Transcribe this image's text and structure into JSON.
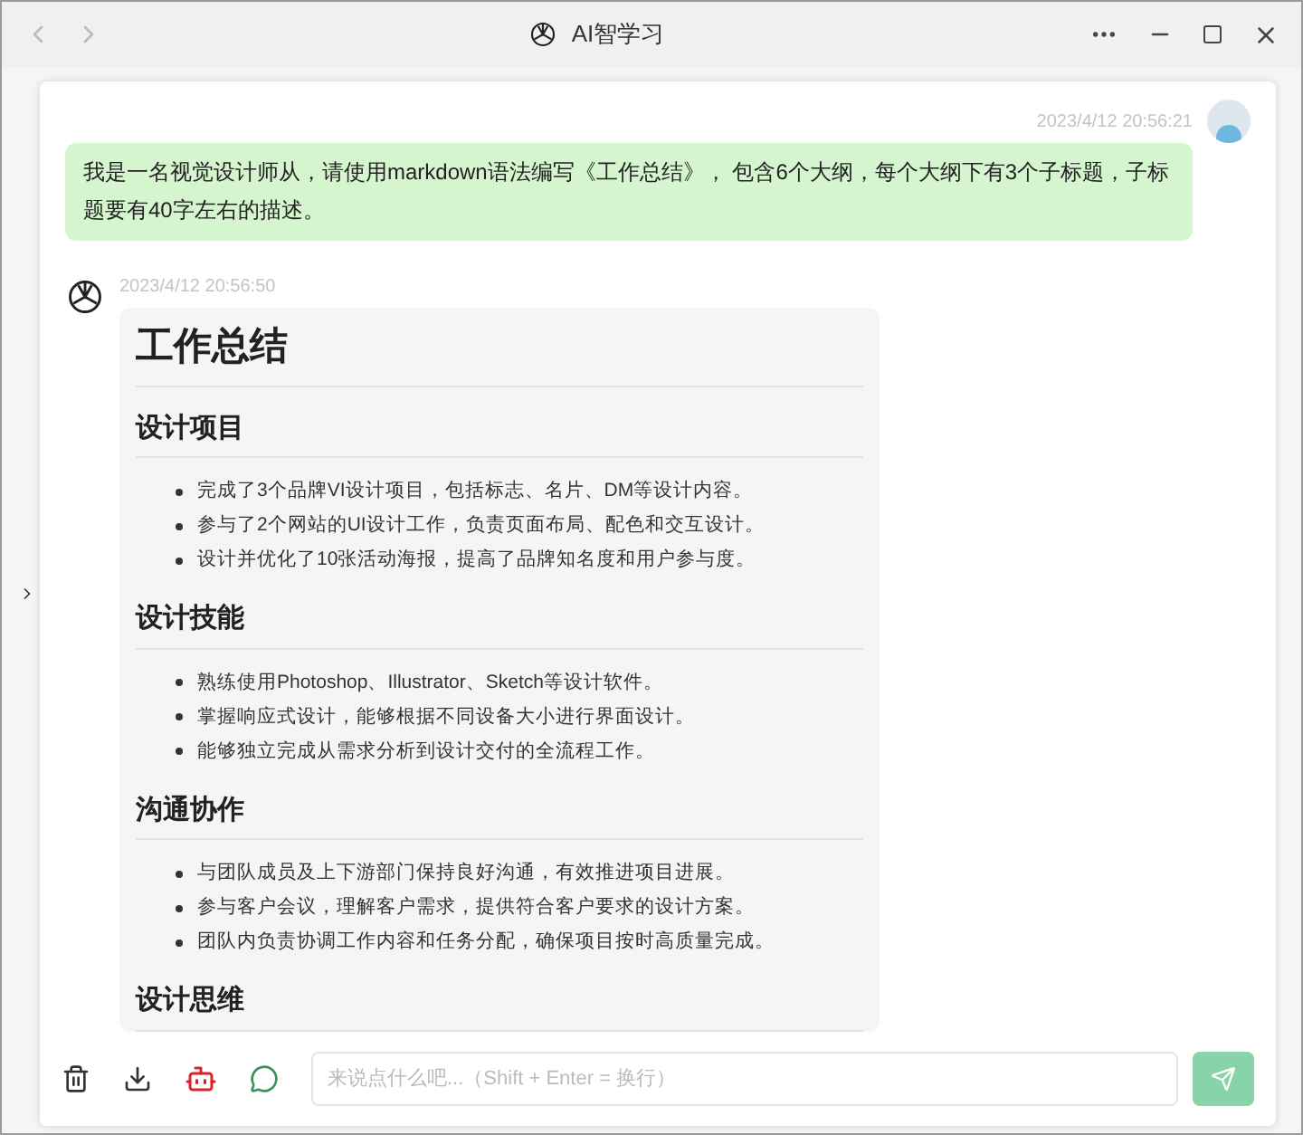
{
  "window": {
    "title": "AI智学习"
  },
  "messages": [
    {
      "kind": "user",
      "time": "2023/4/12 20:56:21",
      "text": "我是一名视觉设计师从，请使用markdown语法编写《工作总结》， 包含6个大纲，每个大纲下有3个子标题，子标题要有40字左右的描述。"
    },
    {
      "kind": "assistant",
      "time": "2023/4/12 20:56:50",
      "title": "工作总结",
      "sections": [
        {
          "heading": "设计项目",
          "items": [
            "完成了3个品牌VI设计项目，包括标志、名片、DM等设计内容。",
            "参与了2个网站的UI设计工作，负责页面布局、配色和交互设计。",
            "设计并优化了10张活动海报，提高了品牌知名度和用户参与度。"
          ]
        },
        {
          "heading": "设计技能",
          "items": [
            "熟练使用Photoshop、Illustrator、Sketch等设计软件。",
            "掌握响应式设计，能够根据不同设备大小进行界面设计。",
            "能够独立完成从需求分析到设计交付的全流程工作。"
          ]
        },
        {
          "heading": "沟通协作",
          "items": [
            "与团队成员及上下游部门保持良好沟通，有效推进项目进展。",
            "参与客户会议，理解客户需求，提供符合客户要求的设计方案。",
            "团队内负责协调工作内容和任务分配，确保项目按时高质量完成。"
          ]
        },
        {
          "heading": "设计思维"
        }
      ]
    }
  ],
  "input": {
    "placeholder": "来说点什么吧...（Shift + Enter = 换行）"
  }
}
